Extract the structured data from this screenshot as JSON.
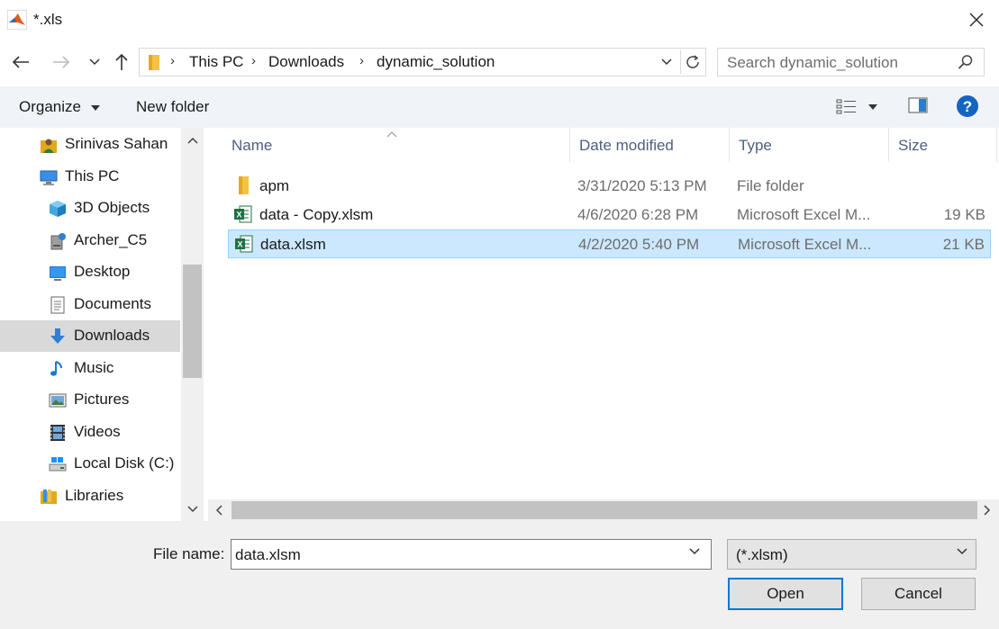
{
  "window": {
    "title": "*.xls"
  },
  "address": {
    "crumbs": [
      "This PC",
      "Downloads",
      "dynamic_solution"
    ]
  },
  "search": {
    "placeholder": "Search dynamic_solution"
  },
  "toolbar": {
    "organize_label": "Organize",
    "new_folder_label": "New folder"
  },
  "sidebar": {
    "items": [
      {
        "label": "Srinivas Sahan",
        "icon": "user-folder-icon"
      },
      {
        "label": "This PC",
        "icon": "computer-icon"
      },
      {
        "label": "3D Objects",
        "icon": "cube-icon"
      },
      {
        "label": "Archer_C5",
        "icon": "network-drive-icon"
      },
      {
        "label": "Desktop",
        "icon": "desktop-icon"
      },
      {
        "label": "Documents",
        "icon": "document-icon"
      },
      {
        "label": "Downloads",
        "icon": "download-arrow-icon",
        "selected": true
      },
      {
        "label": "Music",
        "icon": "music-note-icon"
      },
      {
        "label": "Pictures",
        "icon": "pictures-icon"
      },
      {
        "label": "Videos",
        "icon": "film-icon"
      },
      {
        "label": "Local Disk (C:)",
        "icon": "drive-icon"
      },
      {
        "label": "Libraries",
        "icon": "library-folder-icon"
      }
    ]
  },
  "columns": {
    "name": "Name",
    "date": "Date modified",
    "type": "Type",
    "size": "Size"
  },
  "files": [
    {
      "name": "apm",
      "date": "3/31/2020 5:13 PM",
      "type": "File folder",
      "size": "",
      "icon": "folder-icon"
    },
    {
      "name": "data - Copy.xlsm",
      "date": "4/6/2020 6:28 PM",
      "type": "Microsoft Excel M...",
      "size": "19 KB",
      "icon": "excel-file-icon"
    },
    {
      "name": "data.xlsm",
      "date": "4/2/2020 5:40 PM",
      "type": "Microsoft Excel M...",
      "size": "21 KB",
      "icon": "excel-file-icon",
      "selected": true
    }
  ],
  "footer": {
    "filename_label": "File name:",
    "filename_value": "data.xlsm",
    "filter_value": "(*.xlsm)",
    "open_label": "Open",
    "cancel_label": "Cancel"
  },
  "colors": {
    "accent": "#0078d7",
    "selection": "#cce8ff",
    "folder": "#f5c242",
    "excel": "#1d7145"
  }
}
